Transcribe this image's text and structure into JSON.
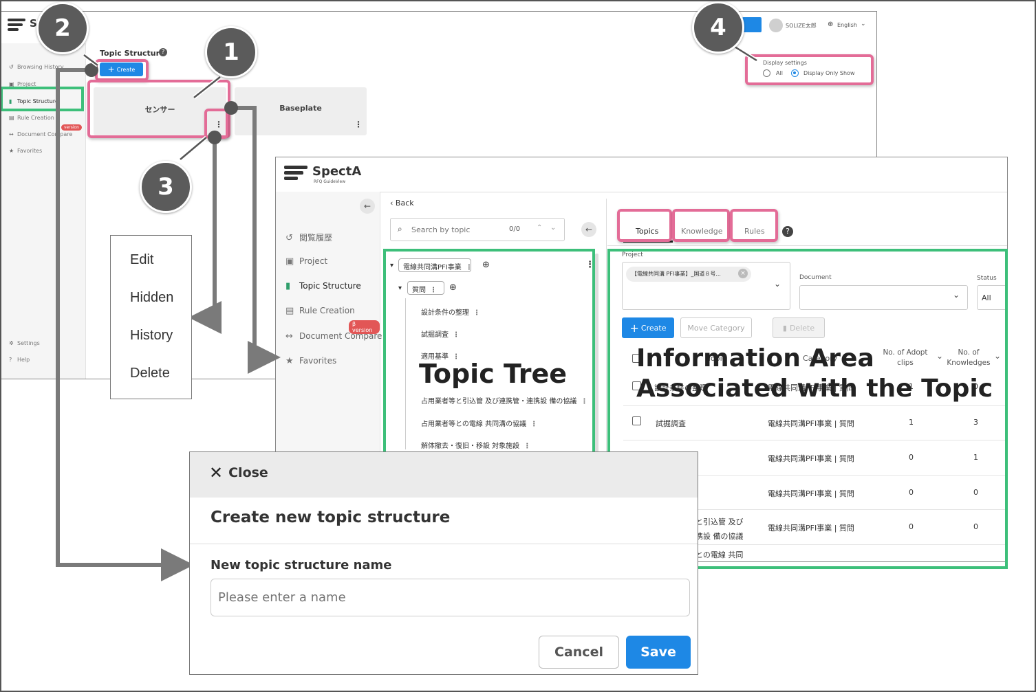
{
  "back_window": {
    "logo_text": "S",
    "user_name": "SOLIZE太郎",
    "language": "English",
    "page_title": "Topic Structure",
    "create_button": "Create",
    "sidebar": {
      "items": [
        {
          "label": "Browsing History"
        },
        {
          "label": "Project"
        },
        {
          "label": "Topic Structure"
        },
        {
          "label": "Rule Creation"
        },
        {
          "label": "Document Compare"
        },
        {
          "label": "Favorites"
        },
        {
          "label": "Settings"
        },
        {
          "label": "Help"
        }
      ],
      "beta_badge": "version"
    },
    "cards": [
      {
        "label": "センサー"
      },
      {
        "label": "Baseplate"
      }
    ],
    "display_settings": {
      "title": "Display settings",
      "option_all": "All",
      "option_only_show": "Display Only Show",
      "selected": "Display Only Show"
    }
  },
  "front_window": {
    "logo_name": "SpectA",
    "logo_sub": "RFQ GuideView",
    "back_label": "Back",
    "search": {
      "placeholder": "Search by topic",
      "count": "0/0"
    },
    "sidebar": {
      "items": [
        {
          "label": "閲覧履歴"
        },
        {
          "label": "Project"
        },
        {
          "label": "Topic Structure"
        },
        {
          "label": "Rule Creation"
        },
        {
          "label": "Document Compare"
        },
        {
          "label": "Favorites"
        }
      ],
      "beta_badge": "β version"
    },
    "tree": {
      "root": "電線共同溝PFI事業",
      "child": "質問",
      "leaves": [
        "設計条件の整理",
        "試掘調査",
        "適用基準",
        "占用業者等と引込管 及び連携管・連携設 備の協議",
        "占用業者等との電線 共同溝の協議",
        "解体撤去・復旧・移設 対象施設"
      ]
    },
    "tabs": [
      "Topics",
      "Knowledge",
      "Rules"
    ],
    "filters": {
      "project_label": "Project",
      "project_chip": "【電線共同溝 PFI事業】_国道８号...",
      "document_label": "Document",
      "status_label": "Status",
      "status_value": "All"
    },
    "actions": {
      "create": "Create",
      "move_category": "Move Category",
      "delete": "Delete"
    },
    "table": {
      "columns": [
        "Topic",
        "Category",
        "No. of Adopt clips",
        "No. of Knowledges"
      ],
      "rows": [
        {
          "topic": "設計条件の整理",
          "category": "電線共同溝PFI事業 | 質問",
          "clips": "1",
          "knowledges": "0"
        },
        {
          "topic": "試掘調査",
          "category": "電線共同溝PFI事業 | 質問",
          "clips": "1",
          "knowledges": "3"
        },
        {
          "topic": "",
          "category": "電線共同溝PFI事業 | 質問",
          "clips": "0",
          "knowledges": "1"
        },
        {
          "topic": "",
          "category": "電線共同溝PFI事業 | 質問",
          "clips": "0",
          "knowledges": "0"
        },
        {
          "topic": "と引込管 及び\n携設 備の協議",
          "category": "電線共同溝PFI事業 | 質問",
          "clips": "0",
          "knowledges": "0"
        },
        {
          "topic": "との電線 共同",
          "category": "",
          "clips": "",
          "knowledges": ""
        }
      ]
    }
  },
  "context_menu": [
    "Edit",
    "Hidden",
    "History",
    "Delete"
  ],
  "dialog": {
    "close_label": "Close",
    "title": "Create new topic structure",
    "field_label": "New topic structure name",
    "placeholder": "Please enter a name",
    "cancel": "Cancel",
    "save": "Save"
  },
  "callouts": [
    "1",
    "2",
    "3",
    "4"
  ],
  "annotations": {
    "topic_tree": "Topic Tree",
    "info_area_line1": "Information Area",
    "info_area_line2": "Associated with the Topic"
  },
  "colors": {
    "accent_blue": "#1e88e5",
    "highlight_pink": "#e36c97",
    "highlight_green": "#3dbf7a",
    "callout_gray": "#5b5b5b",
    "brand_green": "#2f9e6b"
  }
}
